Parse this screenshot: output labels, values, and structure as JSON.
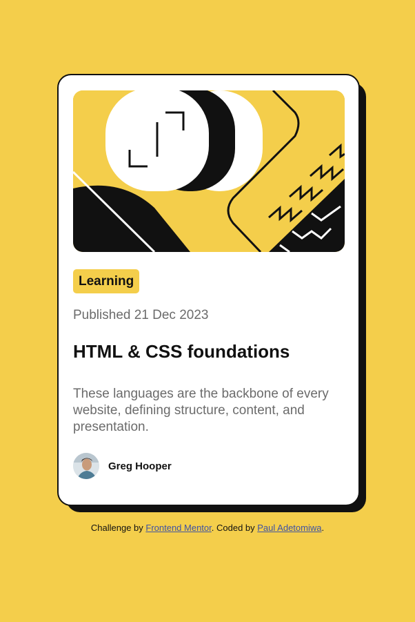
{
  "card": {
    "tag": "Learning",
    "published": "Published 21 Dec 2023",
    "title": "HTML & CSS foundations",
    "description": "These languages are the backbone of every website, defining structure, content, and presentation.",
    "author": "Greg Hooper"
  },
  "attribution": {
    "prefix": "Challenge by ",
    "link1": "Frontend Mentor",
    "middle": ". Coded by ",
    "link2": "Paul Adetomiwa",
    "suffix": "."
  },
  "colors": {
    "background": "#F4CE4B",
    "card": "#FFFFFF",
    "ink": "#111111",
    "muted": "#6B6B6B",
    "link": "#3E52A3"
  },
  "icons": {
    "hero": "abstract-illustration",
    "avatar": "author-avatar-photo"
  }
}
